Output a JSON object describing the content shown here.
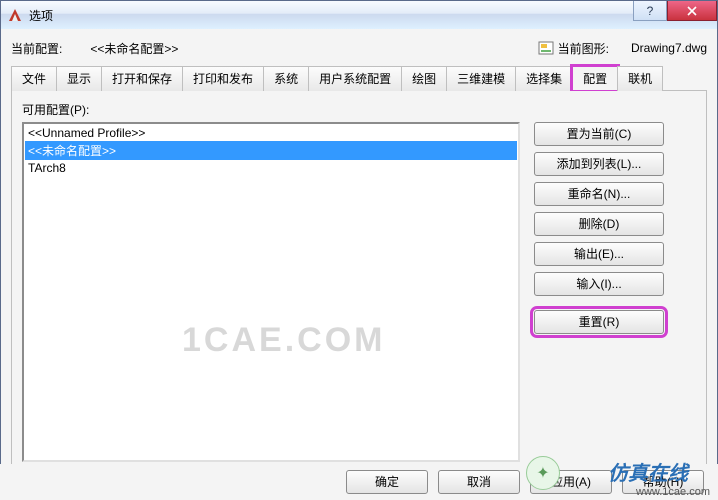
{
  "window": {
    "title": "选项"
  },
  "info": {
    "current_profile_label": "当前配置:",
    "current_profile_value": "<<未命名配置>>",
    "current_drawing_label": "当前图形:",
    "current_drawing_value": "Drawing7.dwg"
  },
  "tabs": [
    {
      "label": "文件"
    },
    {
      "label": "显示"
    },
    {
      "label": "打开和保存"
    },
    {
      "label": "打印和发布"
    },
    {
      "label": "系统"
    },
    {
      "label": "用户系统配置"
    },
    {
      "label": "绘图"
    },
    {
      "label": "三维建模"
    },
    {
      "label": "选择集"
    },
    {
      "label": "配置",
      "active": true,
      "highlight": true
    },
    {
      "label": "联机"
    }
  ],
  "profiles": {
    "label": "可用配置(P):",
    "items": [
      {
        "text": "<<Unnamed Profile>>"
      },
      {
        "text": "<<未命名配置>>",
        "selected": true
      },
      {
        "text": "TArch8"
      }
    ]
  },
  "buttons": {
    "set_current": "置为当前(C)",
    "add_to_list": "添加到列表(L)...",
    "rename": "重命名(N)...",
    "delete": "删除(D)",
    "export": "输出(E)...",
    "import": "输入(I)...",
    "reset": "重置(R)"
  },
  "footer": {
    "ok": "确定",
    "cancel": "取消",
    "apply": "应用(A)",
    "help": "帮助(H)"
  },
  "watermark": "1CAE.COM",
  "overlay": {
    "tag": "仿真在线",
    "url": "www.1cae.com"
  }
}
